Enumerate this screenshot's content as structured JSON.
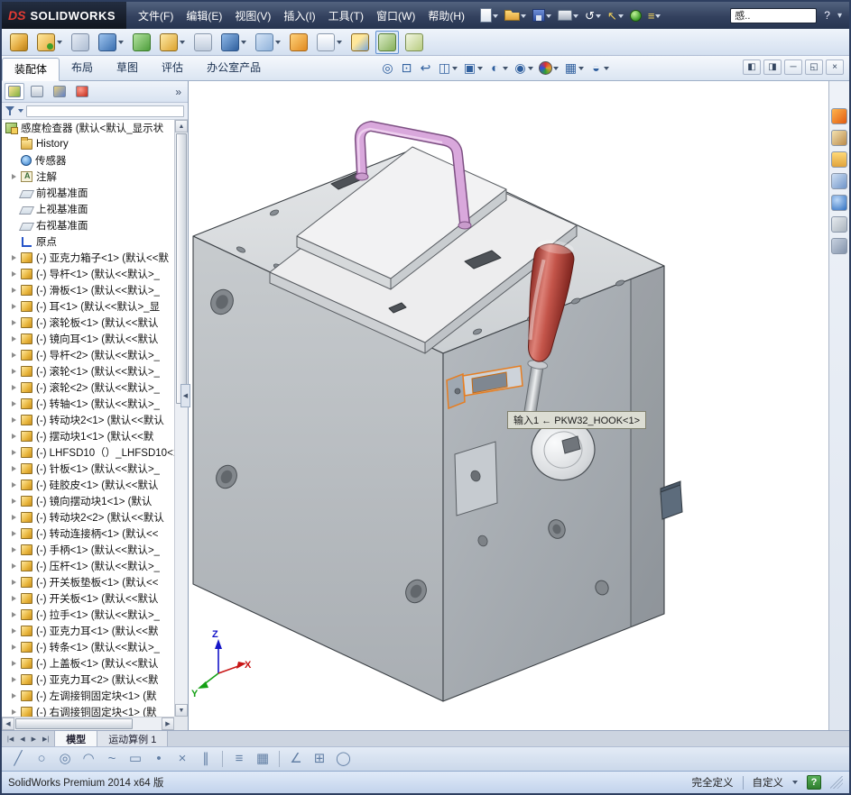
{
  "titlebar": {
    "logo": {
      "mark": "DS",
      "brand": "SOLIDWORKS"
    },
    "menus": [
      "文件(F)",
      "编辑(E)",
      "视图(V)",
      "插入(I)",
      "工具(T)",
      "窗口(W)",
      "帮助(H)"
    ],
    "tools": [
      {
        "name": "new-document-icon",
        "cls": "i-doc",
        "dd": true
      },
      {
        "name": "open-icon",
        "cls": "i-folder",
        "dd": true
      },
      {
        "name": "save-icon",
        "cls": "i-save",
        "dd": true
      },
      {
        "name": "print-icon",
        "cls": "i-print",
        "dd": true
      },
      {
        "name": "undo-icon",
        "cls": "i-glyph",
        "glyph": "↺",
        "dd": true
      },
      {
        "name": "select-arrow-icon",
        "cls": "i-glyph",
        "glyph": "↖",
        "dd": true
      },
      {
        "name": "rebuild-icon",
        "cls": "i-rebuild",
        "dd": false
      },
      {
        "name": "options-icon",
        "cls": "i-glyph",
        "glyph": "≡",
        "dd": true
      }
    ],
    "search_value": "感..",
    "help_label": "?",
    "chevron": "▾"
  },
  "toolbar2": [
    {
      "name": "edit-component-icon",
      "cls": "a-gold",
      "dd": false
    },
    {
      "name": "insert-components-icon",
      "cls": "a-gold2",
      "dd": true
    },
    {
      "name": "mate-icon",
      "cls": "a-clip",
      "dd": false
    },
    {
      "name": "linear-pattern-icon",
      "cls": "a-blue",
      "dd": true
    },
    {
      "name": "smart-fasteners-icon",
      "cls": "a-green",
      "dd": false
    },
    {
      "name": "move-component-icon",
      "cls": "a-move",
      "dd": true
    },
    {
      "name": "show-hidden-components-icon",
      "cls": "a-eye",
      "dd": false
    },
    {
      "name": "assembly-features-icon",
      "cls": "a-feat",
      "dd": true
    },
    {
      "name": "reference-geometry-icon",
      "cls": "a-ref",
      "dd": true
    },
    {
      "name": "new-motion-study-icon",
      "cls": "a-motion",
      "dd": false
    },
    {
      "name": "bill-of-materials-icon",
      "cls": "a-bom",
      "dd": true
    },
    {
      "name": "exploded-view-icon",
      "cls": "a-explode",
      "dd": false
    },
    {
      "name": "instant3d-icon",
      "cls": "a-i3d",
      "dd": false,
      "btn": "pressed"
    },
    {
      "name": "large-assembly-mode-icon",
      "cls": "a-sim",
      "dd": false
    }
  ],
  "command_tabs": [
    {
      "label": "装配体",
      "btn": "active"
    },
    {
      "label": "布局"
    },
    {
      "label": "草图"
    },
    {
      "label": "评估"
    },
    {
      "label": "办公室产品"
    }
  ],
  "headsup": [
    {
      "name": "zoom-fit-icon",
      "glyph": "◎",
      "dd": false
    },
    {
      "name": "zoom-area-icon",
      "glyph": "⊡",
      "dd": false
    },
    {
      "name": "previous-view-icon",
      "glyph": "↩",
      "dd": false
    },
    {
      "name": "section-view-icon",
      "glyph": "◫",
      "dd": true
    },
    {
      "name": "view-orientation-icon",
      "glyph": "▣",
      "dd": true
    },
    {
      "name": "display-style-icon",
      "glyph": "◐",
      "dd": true
    },
    {
      "name": "hide-show-items-icon",
      "glyph": "◉",
      "dd": true
    },
    {
      "name": "edit-appearance-icon",
      "cls": "h-ball",
      "dd": true
    },
    {
      "name": "apply-scene-icon",
      "glyph": "▦",
      "dd": true
    },
    {
      "name": "view-settings-icon",
      "glyph": "◒",
      "dd": true
    }
  ],
  "window_controls": [
    {
      "name": "featuremanager-pane-toggle-icon",
      "glyph": "◧"
    },
    {
      "name": "display-pane-toggle-icon",
      "glyph": "◨"
    },
    {
      "name": "minimize-window-icon",
      "glyph": "─"
    },
    {
      "name": "restore-window-icon",
      "glyph": "◱"
    },
    {
      "name": "close-window-icon",
      "glyph": "×"
    }
  ],
  "panel": {
    "tabs": [
      {
        "name": "featuremanager-tab-icon",
        "cls": "p-fm",
        "btn": "active"
      },
      {
        "name": "propertymanager-tab-icon",
        "cls": "p-pm"
      },
      {
        "name": "configurationmanager-tab-icon",
        "cls": "p-cm"
      },
      {
        "name": "displaymanager-tab-icon",
        "cls": "p-dm"
      }
    ],
    "more": "»",
    "collapse_glyph": "◀",
    "root": {
      "label": "感度检查器 (默认<默认_显示状"
    },
    "items": [
      {
        "a": "",
        "icon": "t-history",
        "n": "history-folder-icon",
        "label": "History"
      },
      {
        "a": "",
        "icon": "t-sensors",
        "n": "sensors-icon",
        "label": "传感器"
      },
      {
        "a": "on",
        "icon": "t-ann",
        "n": "annotations-icon",
        "label": "注解"
      },
      {
        "a": "",
        "icon": "t-plane",
        "n": "plane-icon",
        "label": "前视基准面"
      },
      {
        "a": "",
        "icon": "t-plane",
        "n": "plane-icon",
        "label": "上视基准面"
      },
      {
        "a": "",
        "icon": "t-plane",
        "n": "plane-icon",
        "label": "右视基准面"
      },
      {
        "a": "",
        "icon": "t-origin",
        "n": "origin-icon",
        "label": "原点"
      },
      {
        "a": "on",
        "icon": "t-part",
        "n": "part-icon",
        "label": "(-) 亚克力箱子<1> (默认<<默"
      },
      {
        "a": "on",
        "icon": "t-part",
        "n": "part-icon",
        "label": "(-) 导杆<1> (默认<<默认>_"
      },
      {
        "a": "on",
        "icon": "t-part",
        "n": "part-icon",
        "label": "(-) 滑板<1> (默认<<默认>_"
      },
      {
        "a": "on",
        "icon": "t-part",
        "n": "part-icon",
        "label": "(-) 耳<1> (默认<<默认>_显"
      },
      {
        "a": "on",
        "icon": "t-part",
        "n": "part-icon",
        "label": "(-) 滚轮板<1> (默认<<默认"
      },
      {
        "a": "on",
        "icon": "t-part",
        "n": "part-icon",
        "label": "(-) 镜向耳<1> (默认<<默认"
      },
      {
        "a": "on",
        "icon": "t-part",
        "n": "part-icon",
        "label": "(-) 导杆<2> (默认<<默认>_"
      },
      {
        "a": "on",
        "icon": "t-part",
        "n": "part-icon",
        "label": "(-) 滚轮<1> (默认<<默认>_"
      },
      {
        "a": "on",
        "icon": "t-part",
        "n": "part-icon",
        "label": "(-) 滚轮<2> (默认<<默认>_"
      },
      {
        "a": "on",
        "icon": "t-part",
        "n": "part-icon",
        "label": "(-) 转轴<1> (默认<<默认>_"
      },
      {
        "a": "on",
        "icon": "t-part",
        "n": "part-icon",
        "label": "(-) 转动块2<1> (默认<<默认"
      },
      {
        "a": "on",
        "icon": "t-part",
        "n": "part-icon",
        "label": "(-) 摆动块1<1> (默认<<默"
      },
      {
        "a": "on",
        "icon": "t-part",
        "n": "part-icon",
        "label": "(-) LHFSD10（）_LHFSD10<1"
      },
      {
        "a": "on",
        "icon": "t-part",
        "n": "part-icon",
        "label": "(-) 针板<1> (默认<<默认>_"
      },
      {
        "a": "on",
        "icon": "t-part",
        "n": "part-icon",
        "label": "(-) 硅胶皮<1> (默认<<默认"
      },
      {
        "a": "on",
        "icon": "t-part",
        "n": "part-icon",
        "label": "(-) 镜向摆动块1<1> (默认"
      },
      {
        "a": "on",
        "icon": "t-part",
        "n": "part-icon",
        "label": "(-) 转动块2<2> (默认<<默认"
      },
      {
        "a": "on",
        "icon": "t-part",
        "n": "part-icon",
        "label": "(-) 转动连接柄<1> (默认<<"
      },
      {
        "a": "on",
        "icon": "t-part",
        "n": "part-icon",
        "label": "(-) 手柄<1> (默认<<默认>_"
      },
      {
        "a": "on",
        "icon": "t-part",
        "n": "part-icon",
        "label": "(-) 压杆<1> (默认<<默认>_"
      },
      {
        "a": "on",
        "icon": "t-part",
        "n": "part-icon",
        "label": "(-) 开关板垫板<1> (默认<<"
      },
      {
        "a": "on",
        "icon": "t-part",
        "n": "part-icon",
        "label": "(-) 开关板<1> (默认<<默认"
      },
      {
        "a": "on",
        "icon": "t-part",
        "n": "part-icon",
        "label": "(-) 拉手<1> (默认<<默认>_"
      },
      {
        "a": "on",
        "icon": "t-part",
        "n": "part-icon",
        "label": "(-) 亚克力耳<1> (默认<<默"
      },
      {
        "a": "on",
        "icon": "t-part",
        "n": "part-icon",
        "label": "(-) 转条<1> (默认<<默认>_"
      },
      {
        "a": "on",
        "icon": "t-part",
        "n": "part-icon",
        "label": "(-) 上盖板<1> (默认<<默认"
      },
      {
        "a": "on",
        "icon": "t-part",
        "n": "part-icon",
        "label": "(-) 亚克力耳<2> (默认<<默"
      },
      {
        "a": "on",
        "icon": "t-part",
        "n": "part-icon",
        "label": "(-) 左调接铜固定块<1> (默"
      },
      {
        "a": "on",
        "icon": "t-part",
        "n": "part-icon",
        "label": "(-) 右调接铜固定块<1> (默"
      }
    ]
  },
  "viewport": {
    "tooltip": "输入1 ← PKW32_HOOK<1>",
    "triad": {
      "x": "X",
      "y": "Y",
      "z": "Z"
    }
  },
  "taskpane": [
    {
      "name": "solidworks-resources-icon",
      "cls": "tp-res"
    },
    {
      "name": "design-library-icon",
      "cls": "tp-lib"
    },
    {
      "name": "file-explorer-icon",
      "cls": "tp-folder"
    },
    {
      "name": "view-palette-icon",
      "cls": "tp-palette"
    },
    {
      "name": "appearances-icon",
      "cls": "tp-ball"
    },
    {
      "name": "scenes-icon",
      "cls": "tp-scene"
    },
    {
      "name": "custom-properties-icon",
      "cls": "tp-props"
    }
  ],
  "bottom": {
    "nav": [
      {
        "name": "first-tab-button",
        "glyph": "|◀"
      },
      {
        "name": "prev-tab-button",
        "glyph": "◀"
      },
      {
        "name": "next-tab-button",
        "glyph": "▶"
      },
      {
        "name": "last-tab-button",
        "glyph": "▶|"
      }
    ],
    "tabs": [
      {
        "label": "模型",
        "btn": "active"
      },
      {
        "label": "运动算例 1"
      }
    ]
  },
  "sketchbar": {
    "g1": [
      {
        "name": "sketch-line-icon",
        "glyph": "╱"
      },
      {
        "name": "sketch-circle-icon",
        "glyph": "○"
      },
      {
        "name": "sketch-ellipse-icon",
        "glyph": "◎"
      },
      {
        "name": "sketch-arc-icon",
        "glyph": "◠"
      },
      {
        "name": "sketch-spline-icon",
        "glyph": "~"
      },
      {
        "name": "sketch-rectangle-icon",
        "glyph": "▭"
      },
      {
        "name": "sketch-point-icon",
        "glyph": "•"
      },
      {
        "name": "sketch-trim-icon",
        "glyph": "×"
      },
      {
        "name": "sketch-mirror-icon",
        "glyph": "∥"
      }
    ],
    "g2": [
      {
        "name": "sketch-offset-icon",
        "glyph": "≡"
      },
      {
        "name": "sketch-grid-icon",
        "glyph": "▦"
      }
    ],
    "g3": [
      {
        "name": "smart-dimension-icon",
        "glyph": "∠"
      },
      {
        "name": "sketch-table-icon",
        "glyph": "⊞"
      },
      {
        "name": "sketch-pattern-icon",
        "glyph": "◯"
      }
    ]
  },
  "statusbar": {
    "left": "SolidWorks Premium 2014 x64 版",
    "define_state": "完全定义",
    "custom": "自定义",
    "help": "?"
  }
}
